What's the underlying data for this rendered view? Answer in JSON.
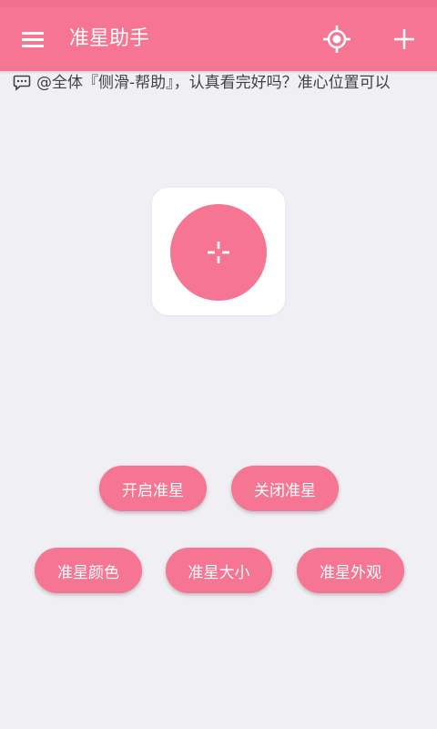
{
  "app": {
    "title": "准星助手"
  },
  "toolbar": {
    "icons": [
      "menu-icon",
      "crosshair-target-icon",
      "plus-icon"
    ]
  },
  "notice": {
    "icon": "chat-bubble-icon",
    "text": "@全体『侧滑-帮助』，认真看完好吗？准心位置可以"
  },
  "preview": {
    "icon": "crosshair-icon"
  },
  "buttons": {
    "open": "开启准星",
    "close": "关闭准星",
    "color": "准星颜色",
    "size": "准星大小",
    "appearance": "准星外观"
  },
  "colors": {
    "accent": "#f57592",
    "background": "#f0eff4",
    "card": "#ffffff"
  }
}
